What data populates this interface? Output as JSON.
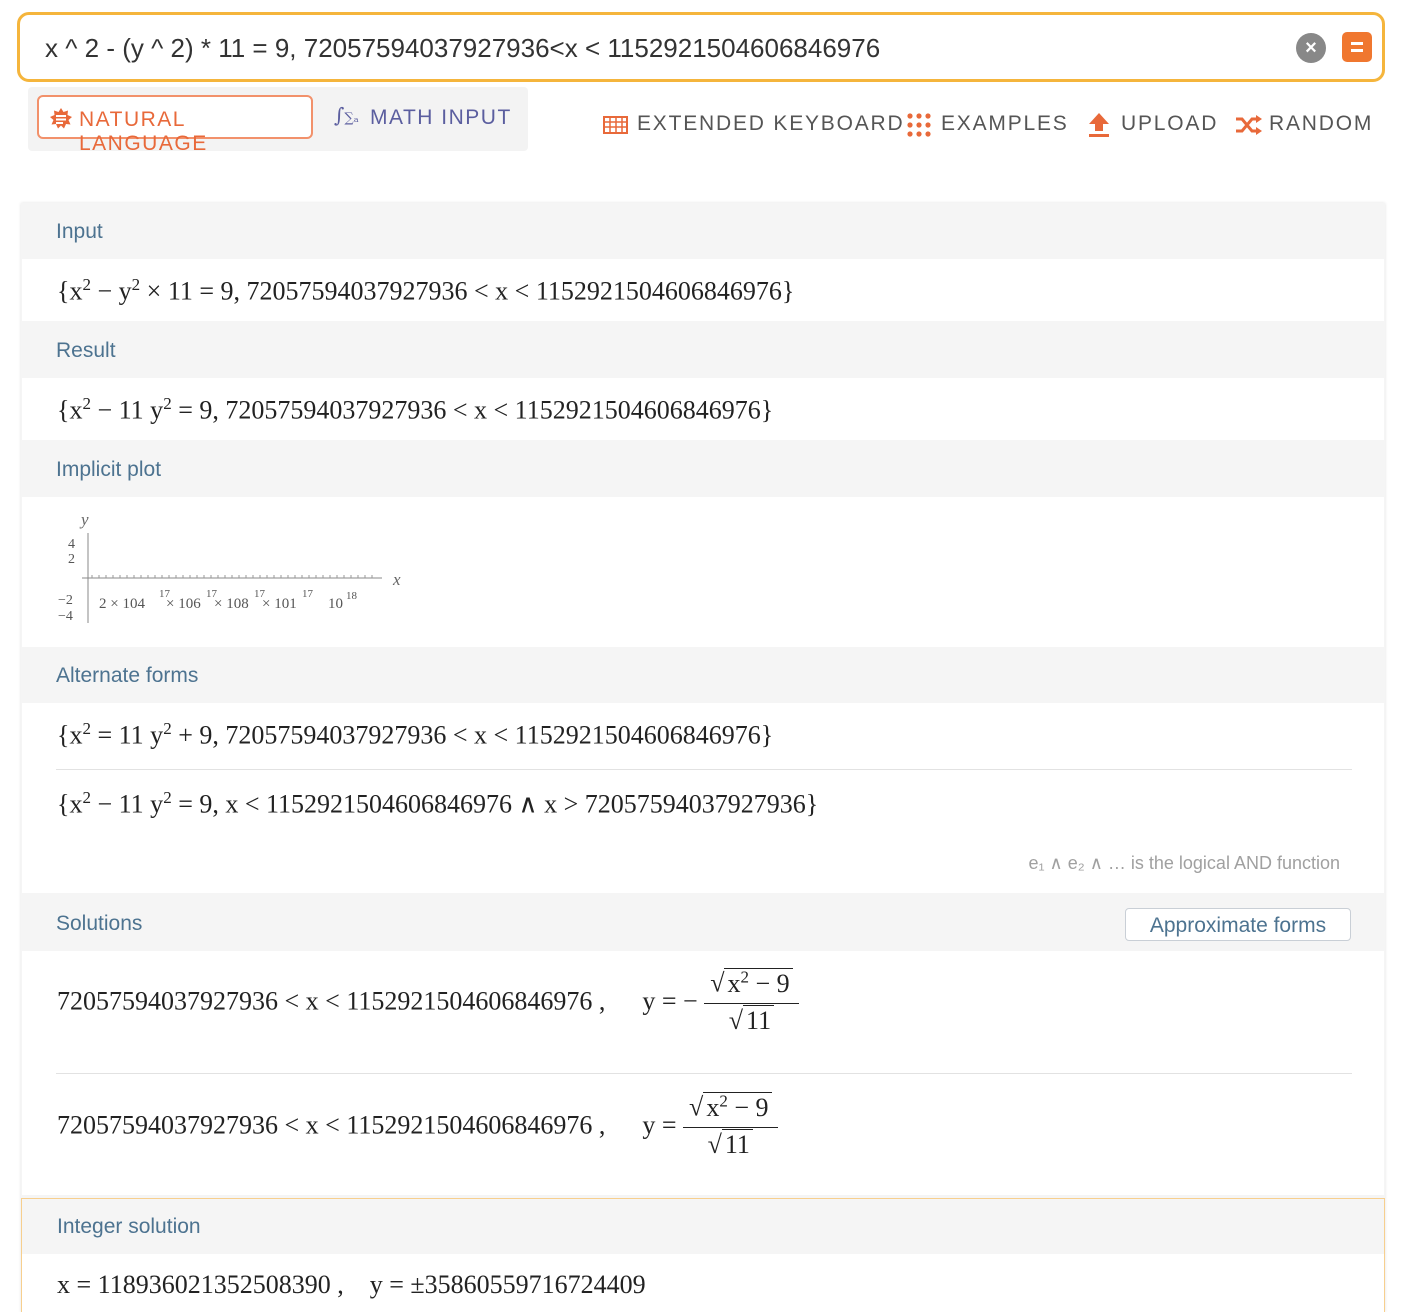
{
  "search": {
    "query": "x ^ 2 - (y ^ 2) * 11 = 9, 72057594037927936<x < 1152921504606846976"
  },
  "modes": {
    "natural_language": "NATURAL LANGUAGE",
    "math_input": "MATH INPUT"
  },
  "toolbar": {
    "extended_keyboard": "EXTENDED KEYBOARD",
    "examples": "EXAMPLES",
    "upload": "UPLOAD",
    "random": "RANDOM"
  },
  "colors": {
    "accent_orange": "#f0772f",
    "search_border": "#f5b53c",
    "pod_title": "#4d7390",
    "math_input_purple": "#5b5e9f"
  },
  "pods": {
    "input": {
      "title": "Input",
      "lead": "{x",
      "exp": "2",
      "mid": " − y",
      "exp2": "2",
      "tail": " × 11 = 9, 72057594037927936 < x < 1152921504606846976}"
    },
    "result": {
      "title": "Result",
      "lead": "{x",
      "exp": "2",
      "mid": " − 11 y",
      "exp2": "2",
      "tail": " = 9, 72057594037927936 < x < 1152921504606846976}"
    },
    "implicit_plot": {
      "title": "Implicit plot",
      "y_axis_label": "y",
      "x_axis_label": "x",
      "y_ticks": [
        "4",
        "2",
        "−2",
        "−4"
      ],
      "x_tick_text": "2 × 10",
      "x_tick_text_2": "× 10",
      "x_tick_text_3": "× 10",
      "x_tick_text_4": "× 10",
      "x_tick_exp": "17",
      "x_tick_pre": "4",
      "x_tick_pre_2": "6",
      "x_tick_pre_3": "8",
      "x_tick_pre_4": "1",
      "x_last_tick": "10",
      "x_last_exp": "18"
    },
    "alternate_forms": {
      "title": "Alternate forms",
      "form1_lead": "{x",
      "form1_exp": "2",
      "form1_mid": " = 11 y",
      "form1_exp2": "2",
      "form1_tail": " + 9, 72057594037927936 < x < 1152921504606846976}",
      "form2_lead": "{x",
      "form2_exp": "2",
      "form2_mid": " − 11 y",
      "form2_exp2": "2",
      "form2_tail": " = 9, x < 1152921504606846976 ∧ x > 72057594037927936}",
      "note": "e₁ ∧ e₂ ∧ … is the logical AND function"
    },
    "solutions": {
      "title": "Solutions",
      "approx_button": "Approximate forms",
      "sol1_range": "72057594037927936 < x < 1152921504606846976 ,",
      "sol1_y": "y = −",
      "sol2_range": "72057594037927936 < x < 1152921504606846976 ,",
      "sol2_y": "y =",
      "numerator_base": "x",
      "numerator_exp": "2",
      "numerator_tail": " − 9",
      "denominator": "11"
    },
    "integer_solution": {
      "title": "Integer solution",
      "value": "x = 118936021352508390 ,    y = ±35860559716724409"
    }
  }
}
